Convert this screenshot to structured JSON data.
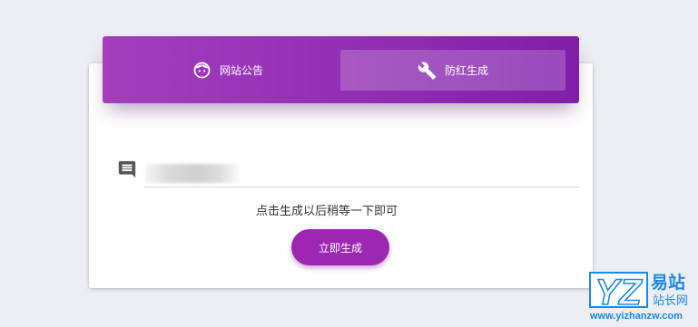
{
  "tabs": [
    {
      "label": "网站公告",
      "icon": "face-icon"
    },
    {
      "label": "防红生成",
      "icon": "wrench-icon",
      "active": true
    }
  ],
  "form": {
    "input_value": "",
    "hint": "点击生成以后稍等一下即可",
    "generate_label": "立即生成"
  },
  "watermark": {
    "letters": "YZ",
    "brand": "易站",
    "sub": "站长网",
    "url": "www.yizhanzw.com"
  },
  "colors": {
    "accent": "#9c27b0",
    "header_start": "#a23fbd",
    "header_end": "#7f1fa8",
    "watermark_blue": "#1e88e5"
  }
}
